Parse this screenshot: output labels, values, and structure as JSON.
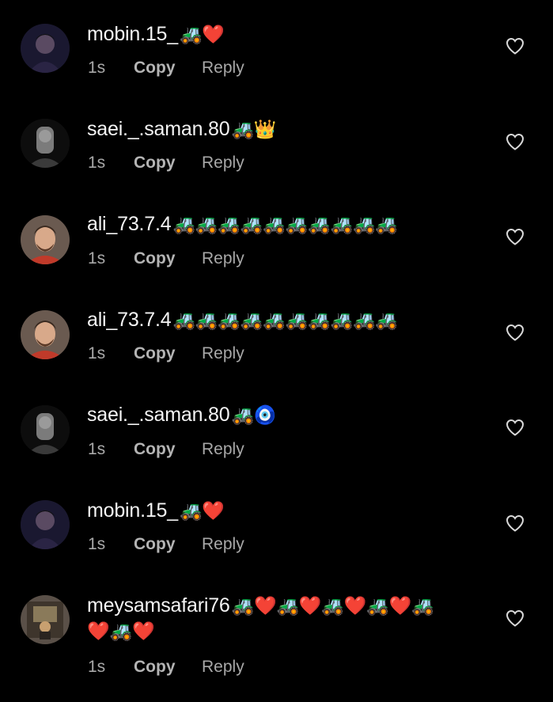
{
  "colors": {
    "background": "#000000",
    "text_primary": "#f4f4f4",
    "text_secondary": "#a8a8a8"
  },
  "comments": [
    {
      "username": "mobin.15_",
      "emoji": "🚜❤️",
      "emoji_line2": "",
      "time": "1s",
      "copy_label": "Copy",
      "reply_label": "Reply",
      "avatar_icon": "person-avatar",
      "like_icon": "heart-outline-icon"
    },
    {
      "username": "saei._.saman.80",
      "emoji": "🚜👑",
      "emoji_line2": "",
      "time": "1s",
      "copy_label": "Copy",
      "reply_label": "Reply",
      "avatar_icon": "person-avatar",
      "like_icon": "heart-outline-icon"
    },
    {
      "username": "ali_73.7.4",
      "emoji": "🚜🚜🚜🚜🚜🚜🚜🚜🚜🚜",
      "emoji_line2": "",
      "time": "1s",
      "copy_label": "Copy",
      "reply_label": "Reply",
      "avatar_icon": "person-avatar",
      "like_icon": "heart-outline-icon"
    },
    {
      "username": "ali_73.7.4",
      "emoji": "🚜🚜🚜🚜🚜🚜🚜🚜🚜🚜",
      "emoji_line2": "",
      "time": "1s",
      "copy_label": "Copy",
      "reply_label": "Reply",
      "avatar_icon": "person-avatar",
      "like_icon": "heart-outline-icon"
    },
    {
      "username": "saei._.saman.80",
      "emoji": "🚜🧿",
      "emoji_line2": "",
      "time": "1s",
      "copy_label": "Copy",
      "reply_label": "Reply",
      "avatar_icon": "person-avatar",
      "like_icon": "heart-outline-icon"
    },
    {
      "username": "mobin.15_",
      "emoji": "🚜❤️",
      "emoji_line2": "",
      "time": "1s",
      "copy_label": "Copy",
      "reply_label": "Reply",
      "avatar_icon": "person-avatar",
      "like_icon": "heart-outline-icon"
    },
    {
      "username": "meysamsafari76",
      "emoji": "🚜❤️🚜❤️🚜❤️🚜❤️🚜",
      "emoji_line2": "❤️🚜❤️",
      "time": "1s",
      "copy_label": "Copy",
      "reply_label": "Reply",
      "avatar_icon": "person-avatar",
      "like_icon": "heart-outline-icon"
    }
  ]
}
